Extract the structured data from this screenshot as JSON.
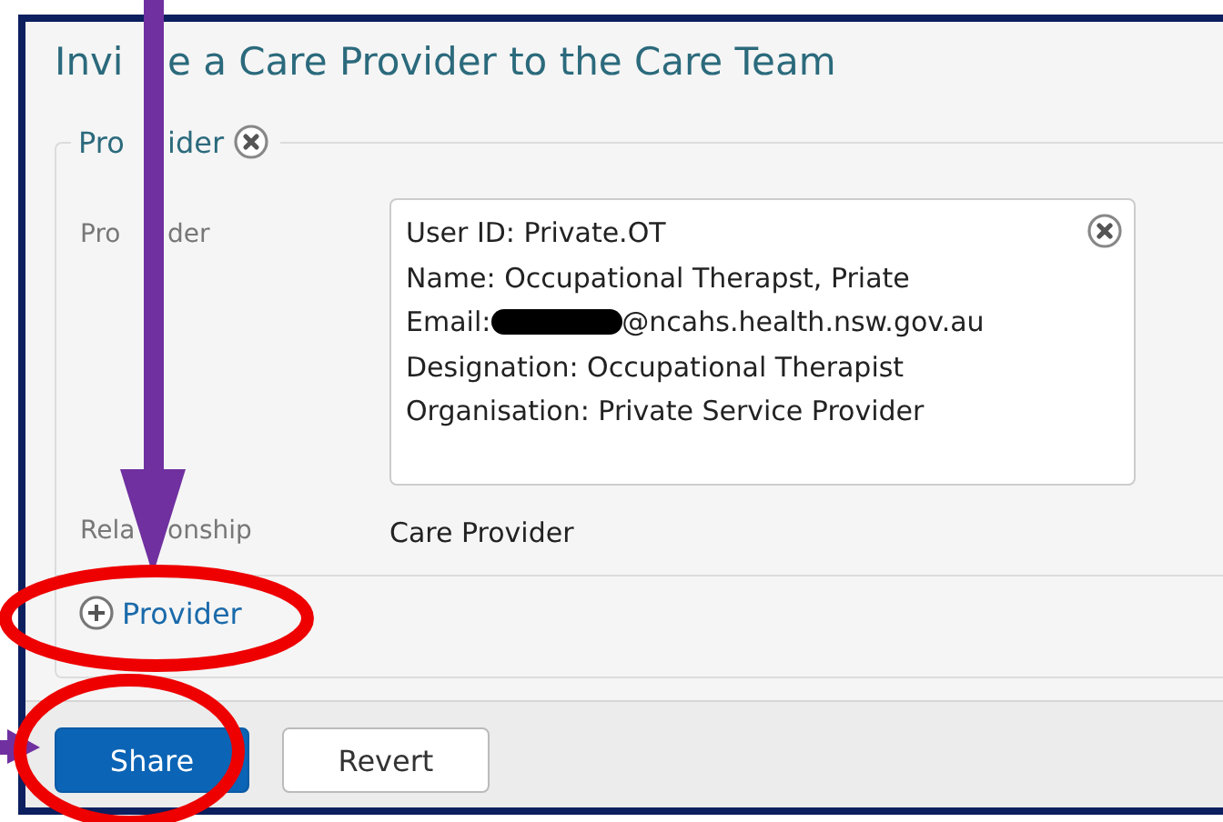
{
  "window": {
    "title": [
      "Invi",
      "e a Care Provider to the Care Team"
    ]
  },
  "section": {
    "legend": [
      "Pro",
      "ider"
    ],
    "fields": [
      {
        "label": [
          "Pro",
          "der"
        ],
        "kind": "card",
        "lines": [
          {
            "text": "User ID: Private.OT",
            "redacted": false
          },
          {
            "text": "Name: Occupational Therapst, Priate",
            "redacted": false
          },
          {
            "prefix": "Email:",
            "text": "@ncahs.health.nsw.gov.au",
            "redacted": true
          },
          {
            "text": "Designation: Occupational Therapist",
            "redacted": false
          },
          {
            "text": "Organisation: Private Service Provider",
            "redacted": false
          }
        ]
      },
      {
        "label": [
          "Rela",
          "onship"
        ],
        "kind": "text",
        "value": "Care Provider"
      }
    ],
    "add_link": "Provider"
  },
  "buttons": [
    {
      "label": "Share",
      "kind": "primary"
    },
    {
      "label": "Revert",
      "kind": "secondary"
    }
  ]
}
